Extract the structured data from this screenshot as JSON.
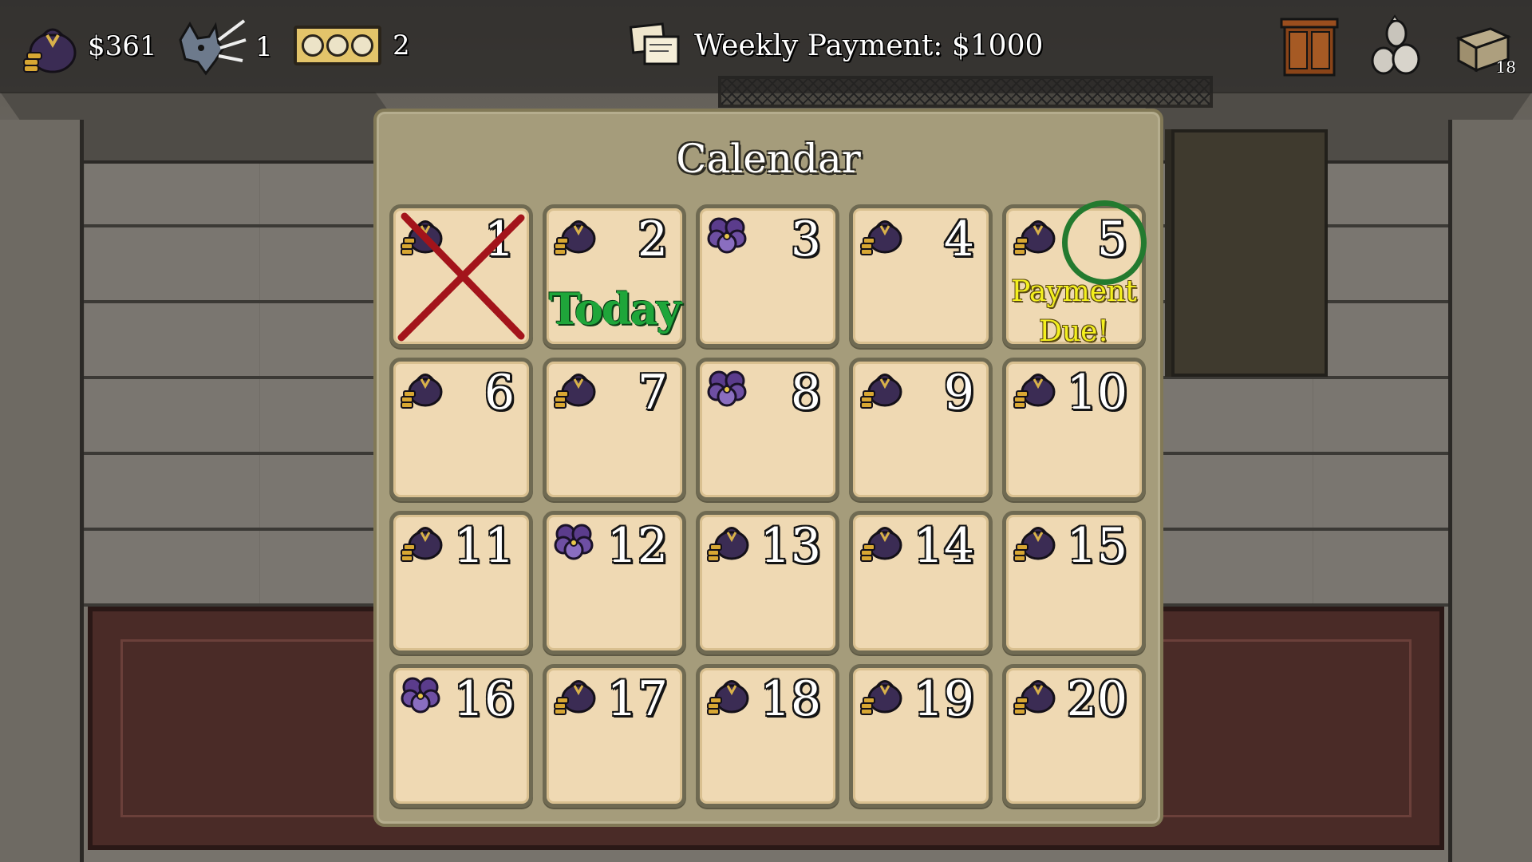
{
  "hud": {
    "money": "$361",
    "wolf_count": "1",
    "ticket_count": "2",
    "weekly_payment": "Weekly Payment: $1000",
    "crate_count": "18",
    "icons": {
      "money": "money-bag-icon",
      "wolf": "wolf-head-icon",
      "tickets": "ticket-coins-icon",
      "weekly": "contract-papers-icon",
      "wardrobe": "wardrobe-icon",
      "shop": "figurines-icon",
      "crate": "crate-icon"
    }
  },
  "calendar": {
    "title": "Calendar",
    "today_label": "Today",
    "payment_label_line1": "Payment",
    "payment_label_line2": "Due!",
    "colors": {
      "today": "#1fa63a",
      "payment": "#f4f01e",
      "cross": "#a3141b",
      "circle": "#237a2f"
    },
    "days": [
      {
        "number": "1",
        "icon": "money-bag-icon"
      },
      {
        "number": "2",
        "icon": "money-bag-icon"
      },
      {
        "number": "3",
        "icon": "pansy-flower-icon"
      },
      {
        "number": "4",
        "icon": "money-bag-icon"
      },
      {
        "number": "5",
        "icon": "money-bag-icon"
      },
      {
        "number": "6",
        "icon": "money-bag-icon"
      },
      {
        "number": "7",
        "icon": "money-bag-icon"
      },
      {
        "number": "8",
        "icon": "pansy-flower-icon"
      },
      {
        "number": "9",
        "icon": "money-bag-icon"
      },
      {
        "number": "10",
        "icon": "money-bag-icon"
      },
      {
        "number": "11",
        "icon": "money-bag-icon"
      },
      {
        "number": "12",
        "icon": "pansy-flower-icon"
      },
      {
        "number": "13",
        "icon": "money-bag-icon"
      },
      {
        "number": "14",
        "icon": "money-bag-icon"
      },
      {
        "number": "15",
        "icon": "money-bag-icon"
      },
      {
        "number": "16",
        "icon": "pansy-flower-icon"
      },
      {
        "number": "17",
        "icon": "money-bag-icon"
      },
      {
        "number": "18",
        "icon": "money-bag-icon"
      },
      {
        "number": "19",
        "icon": "money-bag-icon"
      },
      {
        "number": "20",
        "icon": "money-bag-icon"
      }
    ],
    "crossed_day": "1",
    "today_day": "2",
    "payment_day": "5"
  }
}
